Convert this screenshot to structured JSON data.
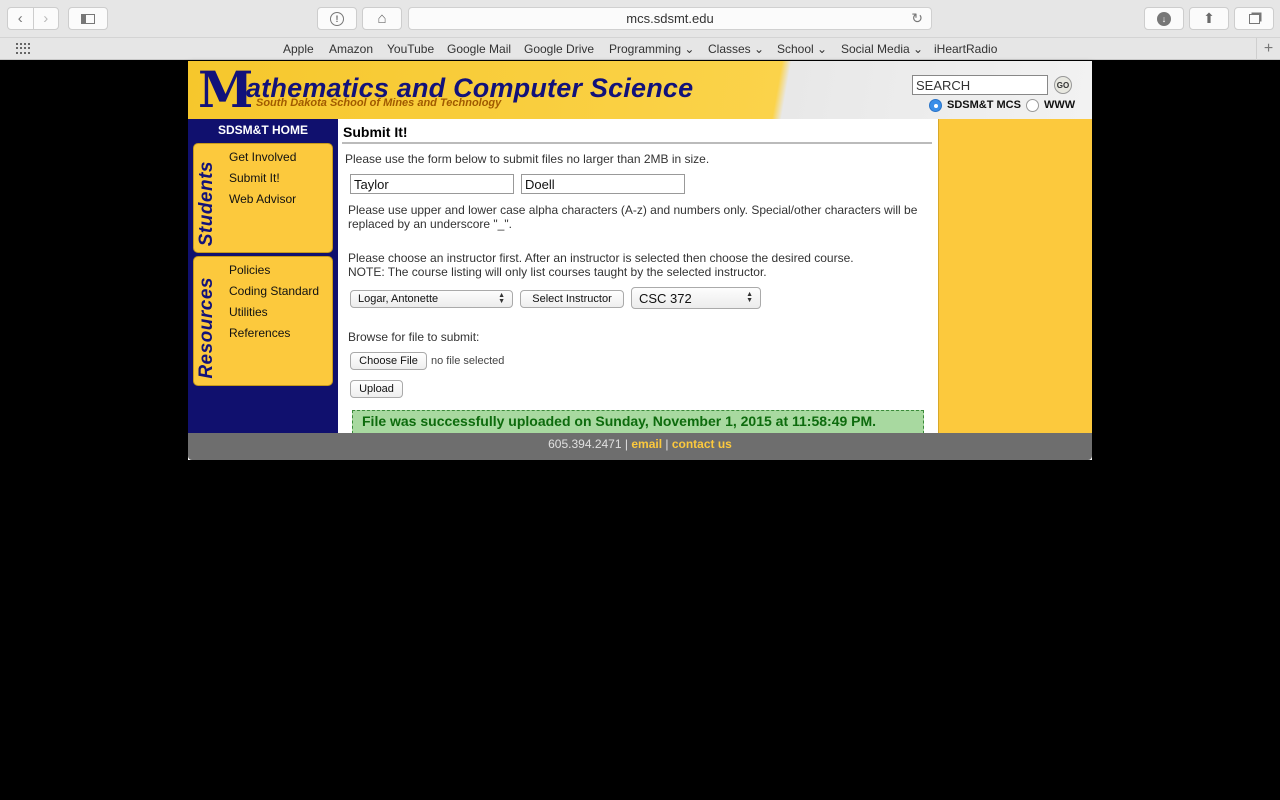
{
  "browser": {
    "url": "mcs.sdsmt.edu",
    "favorites": [
      "Apple",
      "Amazon",
      "YouTube",
      "Google Mail",
      "Google Drive",
      "Programming ⌄",
      "Classes ⌄",
      "School ⌄",
      "Social Media ⌄",
      "iHeartRadio"
    ]
  },
  "header": {
    "logo_letter": "M",
    "logo_title": "athematics and Computer Science",
    "logo_subtitle": "South Dakota School of Mines and Technology",
    "search_value": "SEARCH",
    "go_label": "GO",
    "scope_options": [
      "SDSM&T MCS",
      "WWW"
    ],
    "scope_selected": "SDSM&T MCS"
  },
  "leftnav": {
    "home": "SDSM&T HOME",
    "students_label": "Students",
    "students_items": [
      "Get Involved",
      "Submit It!",
      "Web Advisor"
    ],
    "resources_label": "Resources",
    "resources_items": [
      "Policies",
      "Coding Standard",
      "Utilities",
      "References"
    ]
  },
  "main": {
    "title": "Submit It!",
    "intro": "Please use the form below to submit files no larger than 2MB in size.",
    "first_name": "Taylor",
    "last_name": "Doell",
    "name_note": "Please use upper and lower case alpha characters (A-z) and numbers only. Special/other characters will be replaced by an underscore \"_\".",
    "instructor_note": "Please choose an instructor first. After an instructor is selected then choose the desired course.",
    "course_note": "NOTE: The course listing will only list courses taught by the selected instructor.",
    "instructor_selected": "Logar, Antonette",
    "select_instructor_label": "Select Instructor",
    "course_selected": "CSC 372",
    "browse_label": "Browse for file to submit:",
    "choose_file_label": "Choose File",
    "no_file_label": "no file selected",
    "upload_label": "Upload",
    "success_message": "File was successfully uploaded on Sunday, November 1, 2015 at 11:58:49 PM."
  },
  "footer": {
    "phone": "605.394.2471",
    "sep": "|",
    "email": "email",
    "contact": "contact us"
  },
  "colors": {
    "navy": "#10106e",
    "gold": "#fcc93d",
    "success_bg": "#a8d9a0",
    "success_text": "#0d6b0d"
  }
}
